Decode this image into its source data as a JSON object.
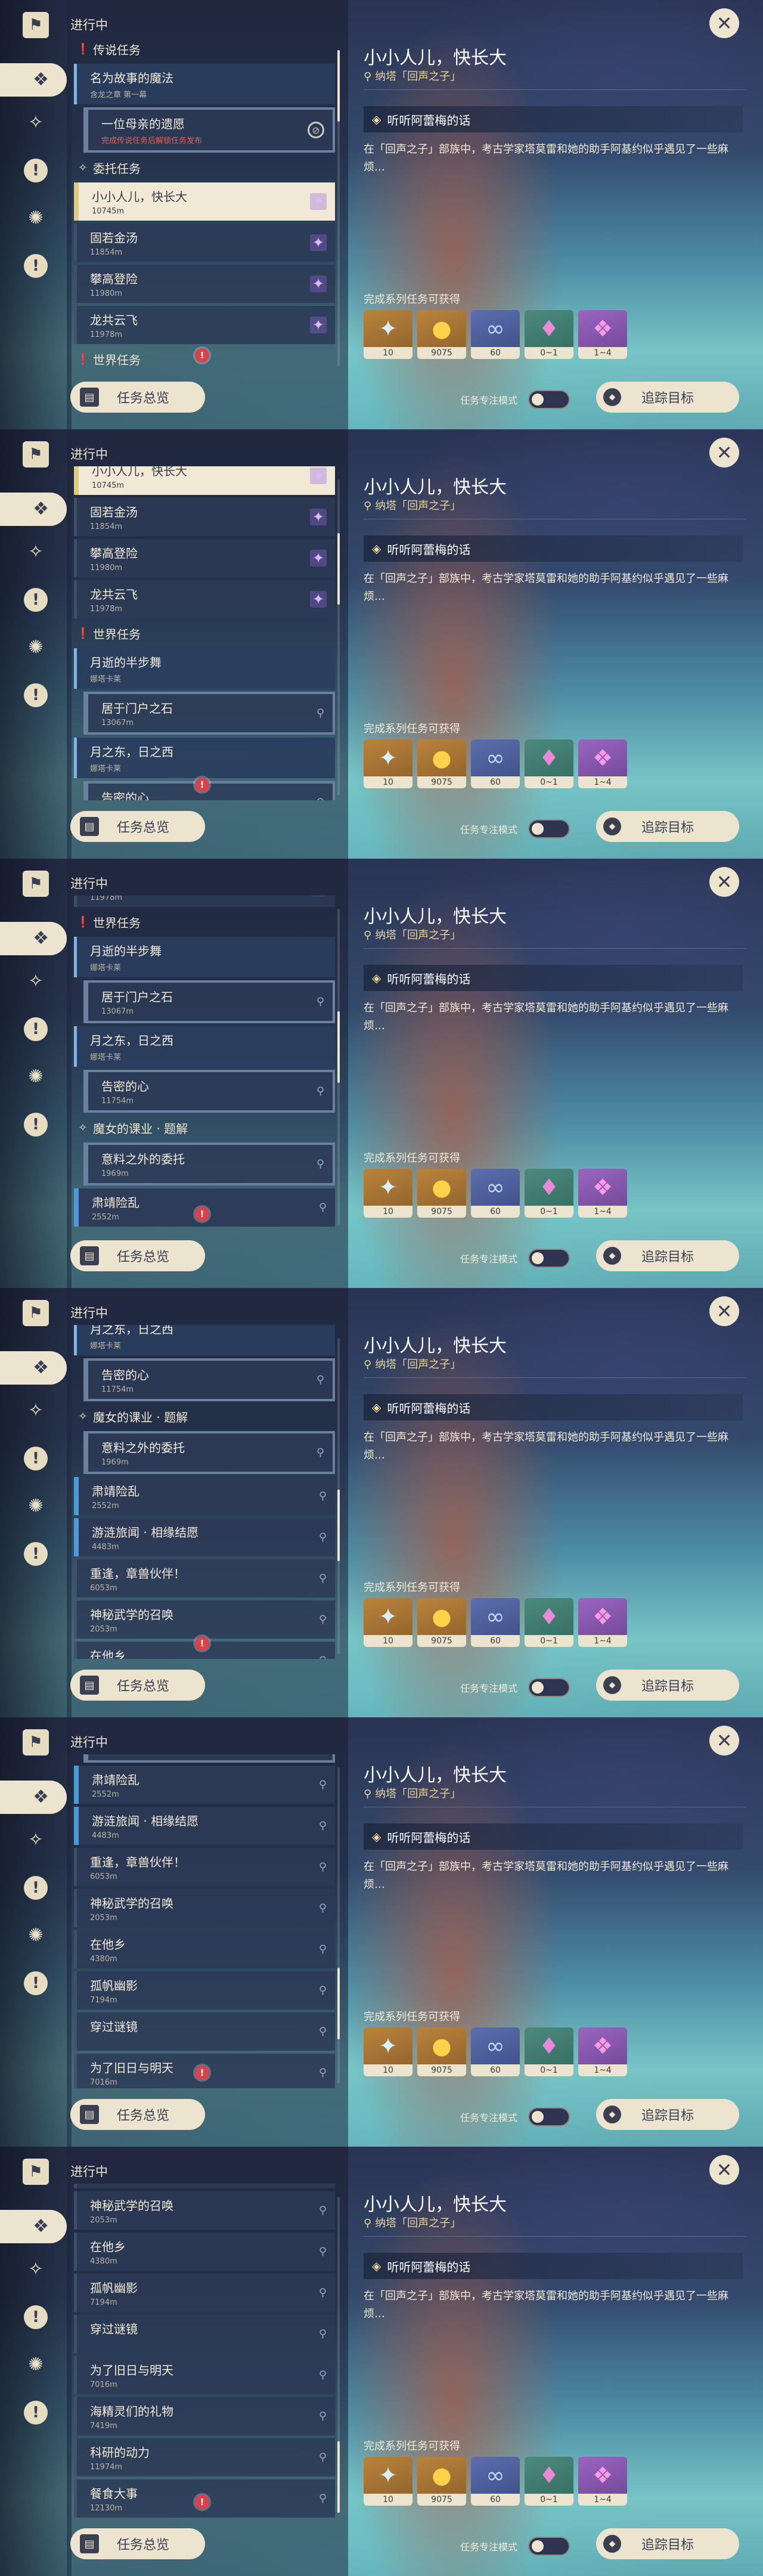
{
  "ui": {
    "status_title": "进行中",
    "overview_label": "任务总览",
    "focus_label": "任务专注模式",
    "track_label": "追踪目标"
  },
  "detail": {
    "title": "小小人儿，快长大",
    "location": "纳塔「回声之子」",
    "objective": "听听阿蕾梅的话",
    "description": "在「回声之子」部族中，考古学家塔莫雷和她的助手阿基约似乎遇见了一些麻烦…",
    "reward_label": "完成系列任务可获得",
    "rewards": [
      {
        "count": "10",
        "icon": "star-icon",
        "tone": "gold"
      },
      {
        "count": "9075",
        "icon": "mora-coin-icon",
        "tone": "gold"
      },
      {
        "count": "60",
        "icon": "ring-icon",
        "tone": "blue"
      },
      {
        "count": "0~1",
        "icon": "crystal-icon",
        "tone": "green"
      },
      {
        "count": "1~4",
        "icon": "crystal-cluster-icon",
        "tone": "purple"
      }
    ]
  },
  "nav": [
    "quest-book-icon",
    "quests-icon",
    "compass-icon",
    "alert-icon",
    "sparkle-icon",
    "info-icon"
  ],
  "quests": {
    "legend_header": "传说任务",
    "legend_quest": {
      "name": "名为故事的魔法",
      "sub": "含龙之章 第一幕"
    },
    "legend_sub": {
      "name": "一位母亲的遗愿",
      "sub": "完成传说任务后解锁任务发布"
    },
    "commission_header": "委托任务",
    "c1": {
      "name": "小小人儿，快长大",
      "dist": "10745m"
    },
    "c2": {
      "name": "固若金汤",
      "dist": "11854m"
    },
    "c3": {
      "name": "攀高登险",
      "dist": "11980m"
    },
    "c4": {
      "name": "龙共云飞",
      "dist": "11978m"
    },
    "world_header": "世界任务",
    "w1": {
      "name": "月逝的半步舞",
      "sub": "娜塔卡莱"
    },
    "w1a": {
      "name": "居于门户之石",
      "dist": "13067m"
    },
    "w2": {
      "name": "月之东，日之西",
      "sub": "娜塔卡莱"
    },
    "w2a": {
      "name": "告密的心",
      "dist": "11754m"
    },
    "witch_header": "魔女的课业 · 题解",
    "wt1": {
      "name": "意料之外的委托",
      "dist": "1969m"
    },
    "x1": {
      "name": "肃靖险乱",
      "dist": "2552m"
    },
    "x2": {
      "name": "游涟旅闻 · 相缘结愿",
      "dist": "4483m"
    },
    "x3": {
      "name": "重逢，章兽伙伴！",
      "dist": "6053m"
    },
    "x4": {
      "name": "神秘武学的召唤",
      "dist": "2053m"
    },
    "x5": {
      "name": "在他乡",
      "dist": "4380m"
    },
    "x6": {
      "name": "孤帆幽影",
      "dist": "7194m"
    },
    "x7": {
      "name": "穿过谜镜"
    },
    "x8": {
      "name": "为了旧日与明天",
      "dist": "7016m"
    },
    "x9": {
      "name": "海精灵们的礼物",
      "dist": "7419m"
    },
    "x10": {
      "name": "科研的动力",
      "dist": "11974m"
    },
    "x11": {
      "name": "餐食大事",
      "dist": "12130m"
    }
  },
  "scroll_positions": [
    0,
    0.22,
    0.42,
    0.62,
    0.82,
    1.0
  ]
}
